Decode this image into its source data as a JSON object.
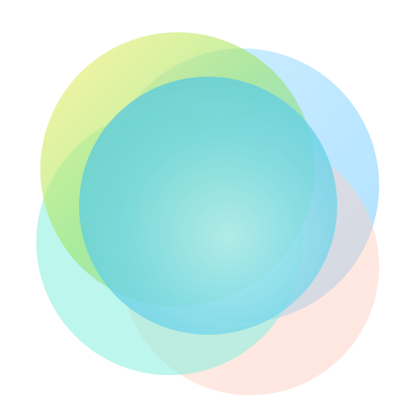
{
  "image": {
    "background_color": "#ffffff",
    "palette": {
      "yellow": "#fff06a",
      "green": "#9ee56a",
      "cyan": "#63d8e6",
      "sky_blue": "#8fd6ff",
      "aqua": "#86eedf",
      "peach": "#ffc7b8",
      "center_highlight": "#b8eef4"
    },
    "shape_names": [
      "yellow-green-circle",
      "sky-blue-circle",
      "aqua-circle",
      "peach-circle",
      "center-cyan-circle"
    ]
  }
}
